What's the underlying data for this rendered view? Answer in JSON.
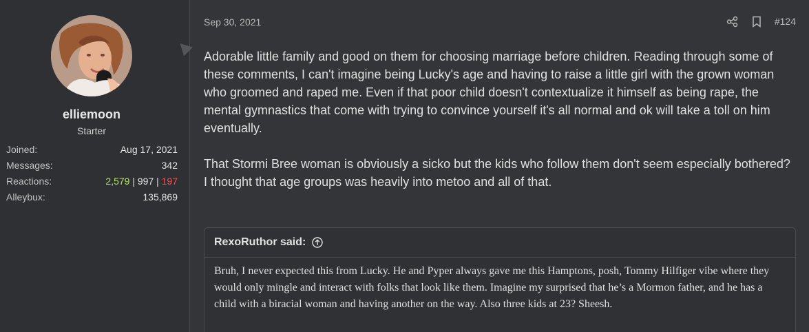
{
  "user": {
    "name": "elliemoon",
    "title": "Starter",
    "stats": {
      "joined_label": "Joined:",
      "joined_value": "Aug 17, 2021",
      "messages_label": "Messages:",
      "messages_value": "342",
      "reactions_label": "Reactions:",
      "reactions_positive": "2,579",
      "reactions_separator1": " | ",
      "reactions_neutral": "997",
      "reactions_separator2": " | ",
      "reactions_negative": "197",
      "alleybux_label": "Alleybux:",
      "alleybux_value": "135,869"
    }
  },
  "post": {
    "date": "Sep 30, 2021",
    "number": "#124",
    "paragraphs": [
      "Adorable little family and good on them for choosing marriage before children. Reading through some of these comments, I can't imagine being Lucky's age and having to raise a little girl with the grown woman who groomed and raped me. Even if that poor child doesn't contextualize it himself as being rape, the mental gymnastics that come with trying to convince yourself it's all normal and ok will take a toll on him eventually.",
      "That Stormi Bree woman is obviously a sicko but the kids who follow them don't seem especially bothered? I thought that age groups was heavily into metoo and all of that."
    ],
    "quote": {
      "author": "RexoRuthor said:",
      "text": "Bruh, I never expected this from Lucky. He and Pyper always gave me this Hamptons, posh, Tommy Hilfiger vibe where they would only mingle and interact with folks that look like them. Imagine my surprised that he’s a Mormon father, and he has a child with a biracial woman and having another on the way. Also three kids at 23? Sheesh."
    }
  },
  "icons": {
    "share": "share-icon",
    "bookmark": "bookmark-icon",
    "quote_up": "arrow-up-circle-icon"
  },
  "colors": {
    "background": "#343538",
    "positive": "#b5e35a",
    "negative": "#ff4b4b"
  }
}
